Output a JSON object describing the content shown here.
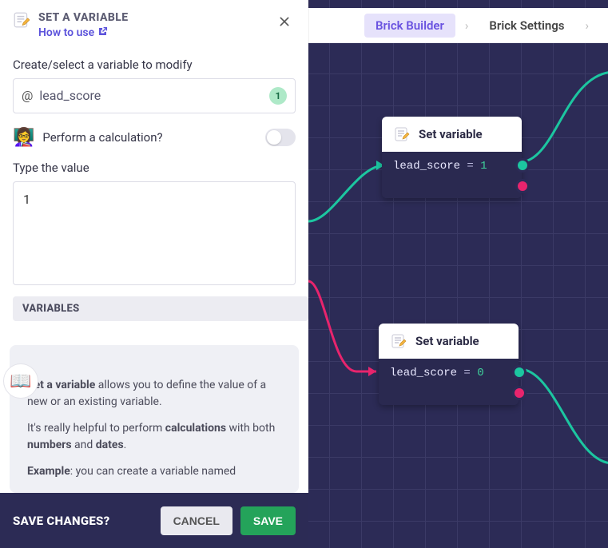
{
  "header": {
    "title": "SET A VARIABLE",
    "how_to_use": "How to use"
  },
  "panel": {
    "select_label": "Create/select a variable to modify",
    "variable_name": "lead_score",
    "variable_badge": "1",
    "calc_label": "Perform a calculation?",
    "type_label": "Type the value",
    "value": "1",
    "variables_chip": "VARIABLES"
  },
  "help": {
    "p1_a": "Set a variable",
    "p1_b": " allows you to define the value of a new or an existing variable.",
    "p2_a": "It's really helpful to perform ",
    "p2_b": "calculations",
    "p2_c": " with both ",
    "p2_d": "numbers",
    "p2_e": " and ",
    "p2_f": "dates",
    "p2_g": ".",
    "p3_a": "Example",
    "p3_b": ": you can create a variable named"
  },
  "footer": {
    "prompt": "SAVE CHANGES?",
    "cancel": "CANCEL",
    "save": "SAVE"
  },
  "tabs": {
    "builder": "Brick Builder",
    "settings": "Brick Settings"
  },
  "nodes": {
    "title": "Set variable",
    "n1": {
      "var": "lead_score",
      "eq": " = ",
      "val": "1"
    },
    "n2": {
      "var": "lead_score",
      "eq": " = ",
      "val": "0"
    }
  },
  "colors": {
    "green": "#1cc6a0",
    "pink": "#e8246d"
  }
}
